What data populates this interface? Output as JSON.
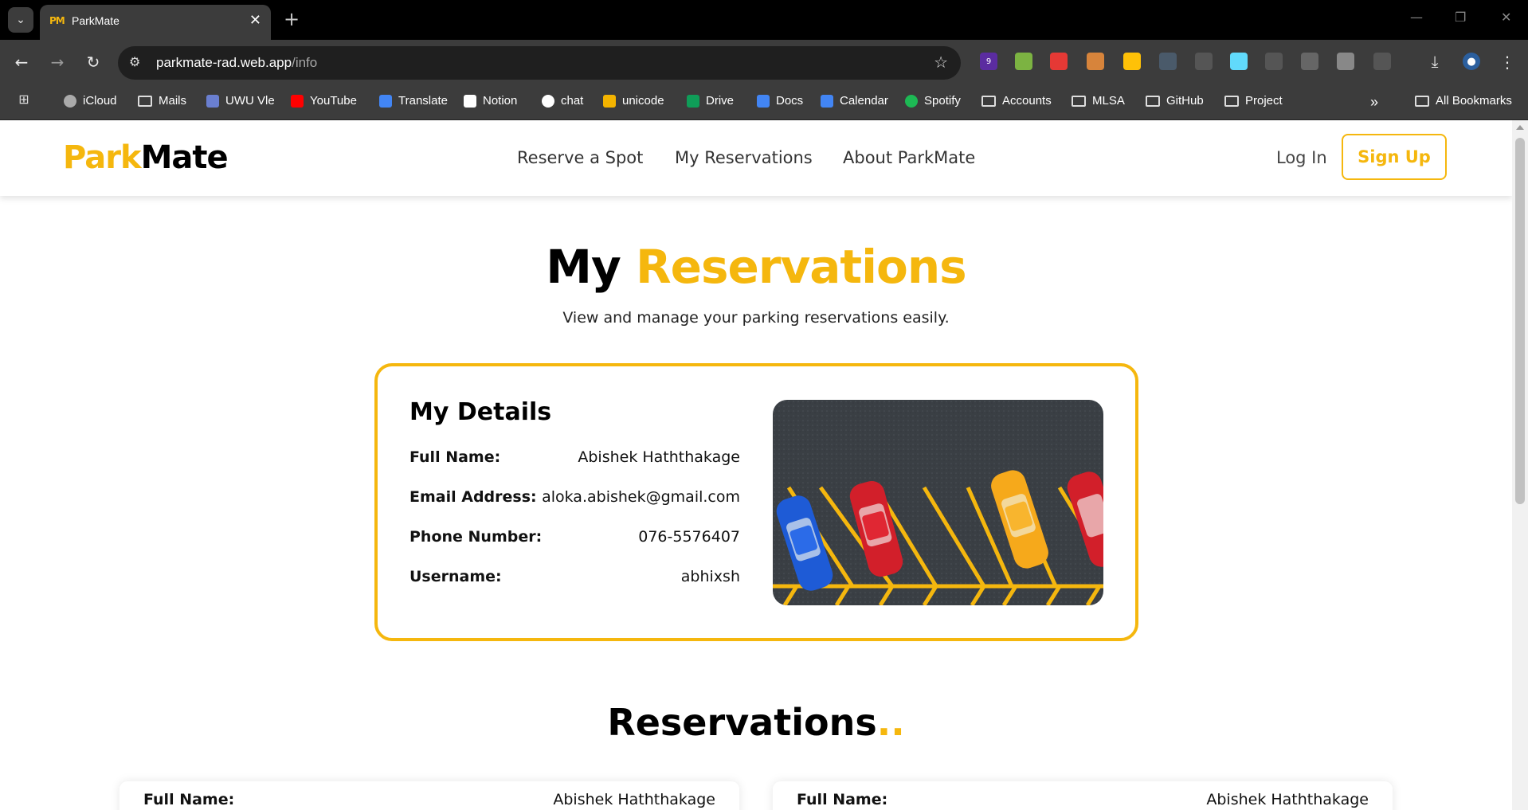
{
  "browser": {
    "tab_title": "ParkMate",
    "tab_favicon": "PM",
    "url_host": "parkmate-rad.web.app",
    "url_path": "/info",
    "extensions": [
      {
        "name": "ext-purple-badge-icon",
        "badge": "9",
        "color": "#5b2ca0"
      },
      {
        "name": "ext-green-icon",
        "color": "#7cb342"
      },
      {
        "name": "ext-red-hand-icon",
        "color": "#e53935"
      },
      {
        "name": "ext-cookie-icon",
        "color": "#d7843b"
      },
      {
        "name": "ext-eyedropper-icon",
        "color": "#ffc107"
      },
      {
        "name": "ext-s-icon",
        "color": "#4a5a6a"
      },
      {
        "name": "ext-image-icon",
        "color": "#555555"
      },
      {
        "name": "ext-react-icon",
        "color": "#61dafb"
      },
      {
        "name": "ext-mouse-icon",
        "color": "#555555"
      },
      {
        "name": "ext-c-icon",
        "color": "#666666"
      },
      {
        "name": "ext-diamond-icon",
        "color": "#888888"
      },
      {
        "name": "ext-puzzle-icon",
        "color": "#555555"
      }
    ],
    "bookmarks": [
      {
        "label": "iCloud",
        "icon": "apple-icon"
      },
      {
        "label": "Mails",
        "icon": "folder-icon"
      },
      {
        "label": "UWU Vle",
        "icon": "uwu-icon"
      },
      {
        "label": "YouTube",
        "icon": "youtube-icon"
      },
      {
        "label": "Translate",
        "icon": "translate-icon"
      },
      {
        "label": "Notion",
        "icon": "notion-icon"
      },
      {
        "label": "chat",
        "icon": "chatgpt-icon"
      },
      {
        "label": "unicode",
        "icon": "unicode-icon"
      },
      {
        "label": "Drive",
        "icon": "drive-icon"
      },
      {
        "label": "Docs",
        "icon": "docs-icon"
      },
      {
        "label": "Calendar",
        "icon": "calendar-icon"
      },
      {
        "label": "Spotify",
        "icon": "spotify-icon"
      },
      {
        "label": "Accounts",
        "icon": "folder-icon"
      },
      {
        "label": "MLSA",
        "icon": "folder-icon"
      },
      {
        "label": "GitHub",
        "icon": "folder-icon"
      },
      {
        "label": "Project",
        "icon": "folder-icon"
      }
    ],
    "all_bookmarks": "All Bookmarks",
    "overflow": "»"
  },
  "site": {
    "logo_part1": "Park",
    "logo_part2": "Mate",
    "nav": [
      "Reserve a Spot",
      "My Reservations",
      "About ParkMate"
    ],
    "login": "Log In",
    "signup": "Sign Up",
    "accent": "#f5b70e"
  },
  "page": {
    "title_part1": "My",
    "title_part2": "Reservations",
    "subtitle": "View and manage your parking reservations easily."
  },
  "details": {
    "title": "My Details",
    "rows": [
      {
        "label": "Full Name:",
        "value": "Abishek Haththakage"
      },
      {
        "label": "Email Address:",
        "value": "aloka.abishek@gmail.com"
      },
      {
        "label": "Phone Number:",
        "value": "076-5576407"
      },
      {
        "label": "Username:",
        "value": "abhixsh"
      }
    ]
  },
  "reservations": {
    "title": "Reservations",
    "dots": "..",
    "cards": [
      {
        "label": "Full Name:",
        "value": "Abishek Haththakage"
      },
      {
        "label": "Full Name:",
        "value": "Abishek Haththakage"
      }
    ]
  }
}
